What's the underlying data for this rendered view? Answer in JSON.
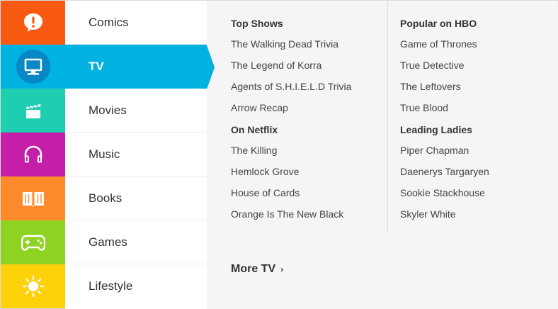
{
  "icons": [
    {
      "name": "alert-icon",
      "color": "#f95a12"
    },
    {
      "name": "tv-icon",
      "color": "#00b2e0"
    },
    {
      "name": "clapperboard-icon",
      "color": "#1dcfb0"
    },
    {
      "name": "headphones-icon",
      "color": "#c51fa9"
    },
    {
      "name": "book-icon",
      "color": "#ff8a2b"
    },
    {
      "name": "gamepad-icon",
      "color": "#8fd322"
    },
    {
      "name": "sun-icon",
      "color": "#fdd20a"
    }
  ],
  "categories": [
    "Comics",
    "TV",
    "Movies",
    "Music",
    "Books",
    "Games",
    "Lifestyle"
  ],
  "active_category": "TV",
  "panel": {
    "left_column": [
      {
        "title": "Top Shows",
        "links": [
          "The Walking Dead Trivia",
          "The Legend of Korra",
          "Agents of S.H.I.E.L.D Trivia",
          "Arrow Recap"
        ]
      },
      {
        "title": "On Netflix",
        "links": [
          "The Killing",
          "Hemlock Grove",
          "House of Cards",
          "Orange Is The New Black"
        ]
      }
    ],
    "right_column": [
      {
        "title": "Popular on HBO",
        "links": [
          "Game of Thrones",
          "True Detective",
          "The Leftovers",
          "True Blood"
        ]
      },
      {
        "title": "Leading Ladies",
        "links": [
          "Piper Chapman",
          "Daenerys Targaryen",
          "Sookie Stackhouse",
          "Skyler White"
        ]
      }
    ],
    "more_label": "More TV",
    "more_chevron": "›"
  }
}
